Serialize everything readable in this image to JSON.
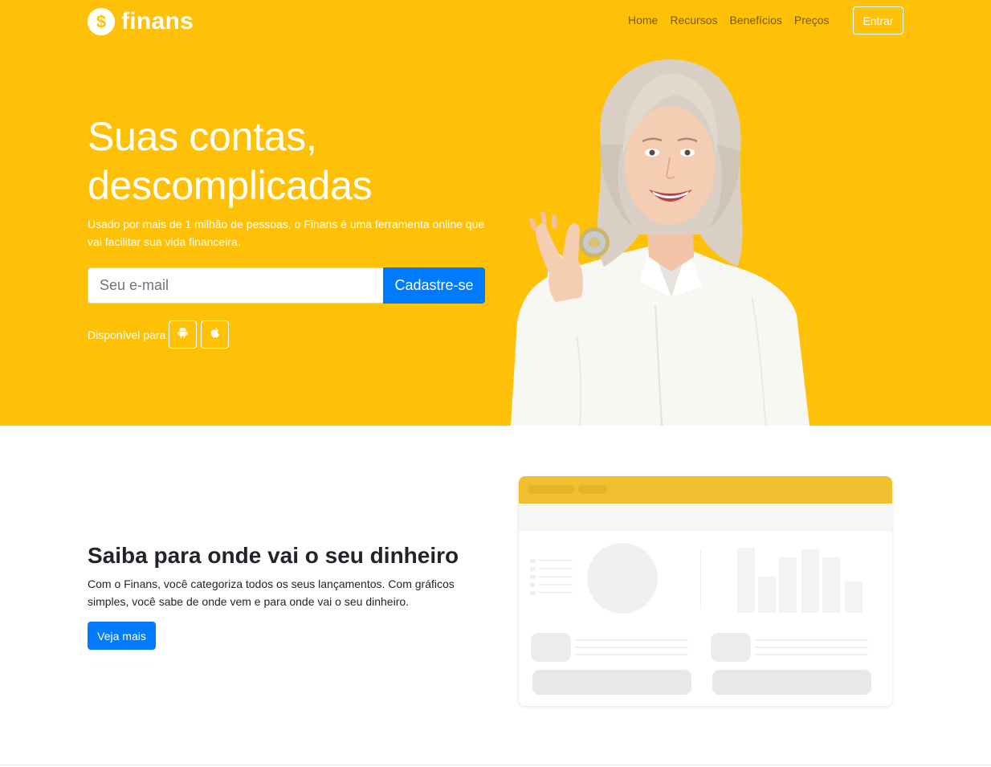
{
  "brand": {
    "name": "finans",
    "icon": "dollar-coin-icon"
  },
  "nav": {
    "links": [
      "Home",
      "Recursos",
      "Benefícios",
      "Preços"
    ],
    "login_label": "Entrar"
  },
  "hero": {
    "title_line1": "Suas contas,",
    "title_line2": "descomplicadas",
    "subtitle": "Usado por mais de 1 milhão de pessoas, o Finans é uma ferramenta online que vai facilitar sua vida financeira.",
    "email_placeholder": "Seu e-mail",
    "email_value": "",
    "signup_label": "Cadastre-se",
    "available_label": "Disponível para",
    "stores": [
      "android-icon",
      "apple-icon"
    ]
  },
  "feature": {
    "title": "Saiba para onde vai o seu dinheiro",
    "text": "Com o Finans, você categoriza todos os seus lançamentos. Com gráficos simples, você sabe de onde vem e para onde vai o seu dinheiro.",
    "button_label": "Veja mais"
  },
  "colors": {
    "hero_background": "#ffc107",
    "primary": "#007bff",
    "mockup_header": "#f0c030"
  }
}
